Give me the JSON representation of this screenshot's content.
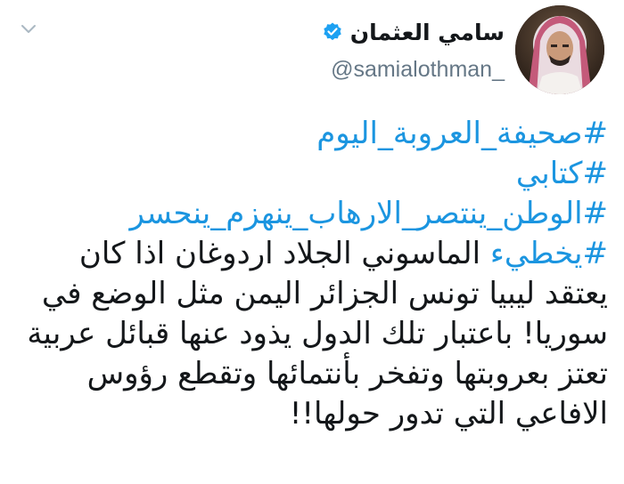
{
  "profile": {
    "display_name": "سامي العثمان",
    "handle": "@samialothman_",
    "avatar_icon": "profile-photo",
    "verified_icon": "verified-badge-icon",
    "menu_icon": "chevron-down-icon"
  },
  "tweet": {
    "hashtags": [
      "#صحيفة_العروبة_اليوم",
      "#كتابي",
      "#الوطن_ينتصر_الارهاب_ينهزم_ينحسر"
    ],
    "inline_hashtag": "#يخطيء",
    "first_line_rest": " الماسوني الجلاد اردوغان اذا كان",
    "lines": [
      "يعتقد ليبيا تونس الجزائر اليمن مثل الوضع في",
      "سوريا! باعتبار تلك الدول يذود عنها قبائل عربية",
      "تعتز بعروبتها وتفخر بأنتمائها وتقطع رؤوس",
      "الافاعي التي تدور حولها!!"
    ]
  },
  "colors": {
    "link": "#1b95e0",
    "text": "#14171a",
    "secondary": "#657786",
    "verified": "#1da1f2"
  }
}
